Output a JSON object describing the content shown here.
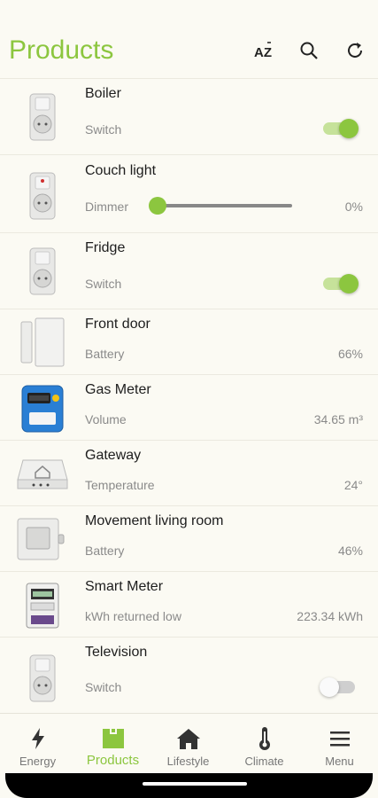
{
  "header": {
    "title": "Products",
    "icons": [
      "sort-az-icon",
      "search-icon",
      "refresh-icon"
    ]
  },
  "products": [
    {
      "name": "Boiler",
      "label": "Switch",
      "type": "toggle",
      "on": true,
      "icon": "plug-icon"
    },
    {
      "name": "Couch light",
      "label": "Dimmer",
      "type": "slider",
      "level": 0,
      "value": "0%",
      "icon": "dimmer-plug-icon"
    },
    {
      "name": "Fridge",
      "label": "Switch",
      "type": "toggle",
      "on": true,
      "icon": "plug-icon"
    },
    {
      "name": "Front door",
      "label": "Battery",
      "type": "value",
      "value": "66%",
      "icon": "door-sensor-icon"
    },
    {
      "name": "Gas Meter",
      "label": "Volume",
      "type": "value",
      "value": "34.65 m³",
      "icon": "gas-meter-icon"
    },
    {
      "name": "Gateway",
      "label": "Temperature",
      "type": "value",
      "value": "24°",
      "icon": "gateway-icon"
    },
    {
      "name": "Movement living room",
      "label": "Battery",
      "type": "value",
      "value": "46%",
      "icon": "motion-sensor-icon"
    },
    {
      "name": "Smart Meter",
      "label": "kWh returned low",
      "type": "value",
      "value": "223.34 kWh",
      "icon": "smart-meter-icon"
    },
    {
      "name": "Television",
      "label": "Switch",
      "type": "toggle",
      "on": false,
      "icon": "plug-icon"
    }
  ],
  "nav": [
    {
      "label": "Energy",
      "icon": "lightning-icon",
      "active": false
    },
    {
      "label": "Products",
      "icon": "products-icon",
      "active": true
    },
    {
      "label": "Lifestyle",
      "icon": "home-icon",
      "active": false
    },
    {
      "label": "Climate",
      "icon": "thermometer-icon",
      "active": false
    },
    {
      "label": "Menu",
      "icon": "menu-icon",
      "active": false
    }
  ],
  "colors": {
    "accent": "#8cc63f",
    "background": "#fbfaf3"
  }
}
